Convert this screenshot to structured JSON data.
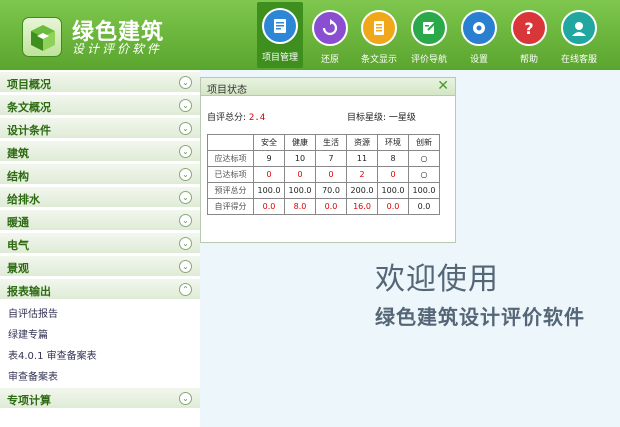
{
  "brand": {
    "title": "绿色建筑",
    "subtitle": "设计评价软件"
  },
  "toolbar": [
    {
      "label": "项目管理",
      "icon": "project-icon",
      "color": "#2e86d6",
      "active": true
    },
    {
      "label": "还原",
      "icon": "restore-icon",
      "color": "#8a4fd1",
      "active": false
    },
    {
      "label": "条文显示",
      "icon": "clause-icon",
      "color": "#f0a81a",
      "active": false
    },
    {
      "label": "评价导航",
      "icon": "navigation-icon",
      "color": "#2aa84a",
      "active": false
    },
    {
      "label": "设置",
      "icon": "gear-icon",
      "color": "#2a7fd1",
      "active": false
    },
    {
      "label": "帮助",
      "icon": "help-icon",
      "color": "#d9363a",
      "active": false
    },
    {
      "label": "在线客服",
      "icon": "support-icon",
      "color": "#22a6a0",
      "active": false
    }
  ],
  "sidebar": {
    "items": [
      {
        "label": "项目概况",
        "expanded": false
      },
      {
        "label": "条文概况",
        "expanded": false
      },
      {
        "label": "设计条件",
        "expanded": false
      },
      {
        "label": "建筑",
        "expanded": false
      },
      {
        "label": "结构",
        "expanded": false
      },
      {
        "label": "给排水",
        "expanded": false
      },
      {
        "label": "暖通",
        "expanded": false
      },
      {
        "label": "电气",
        "expanded": false
      },
      {
        "label": "景观",
        "expanded": false
      },
      {
        "label": "报表输出",
        "expanded": true
      },
      {
        "label": "专项计算",
        "expanded": false
      }
    ],
    "report_subitems": [
      "自评估报告",
      "绿建专篇",
      "表4.0.1 审查备案表",
      "审查备案表"
    ]
  },
  "panel": {
    "title": "项目状态",
    "score_label": "自评总分:",
    "score_value": "2.4",
    "target_label": "目标星级:",
    "target_value": "一星级",
    "columns": [
      "",
      "安全",
      "健康",
      "生活",
      "资源",
      "环境",
      "创新"
    ],
    "rows": [
      {
        "label": "应达标项",
        "values": [
          "9",
          "10",
          "7",
          "11",
          "8",
          "○"
        ],
        "red": false
      },
      {
        "label": "已达标项",
        "values": [
          "0",
          "0",
          "0",
          "2",
          "0",
          "○"
        ],
        "red": true
      },
      {
        "label": "预评总分",
        "values": [
          "100.0",
          "100.0",
          "70.0",
          "200.0",
          "100.0",
          "100.0"
        ],
        "red": false
      },
      {
        "label": "自评得分",
        "values": [
          "0.0",
          "8.0",
          "0.0",
          "16.0",
          "0.0",
          "0.0"
        ],
        "red": true
      }
    ]
  },
  "welcome": {
    "line1": "欢迎使用",
    "line2": "绿色建筑设计评价软件"
  }
}
